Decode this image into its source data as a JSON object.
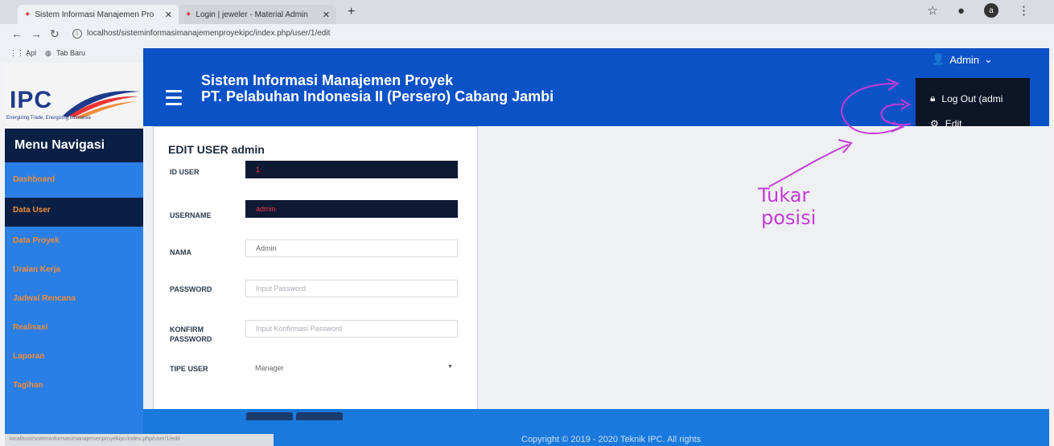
{
  "browser": {
    "tabs": [
      {
        "title": "Sistem Informasi Manajemen Pro",
        "close": "✕"
      },
      {
        "title": "Login | jeweler - Material Admin",
        "close": "✕"
      }
    ],
    "new_tab": "+",
    "url": "localhost/sisteminformasimanajemenproyekipc/index.php/user/1/edit",
    "bookmarks": [
      "Apl",
      "Tab Baru"
    ],
    "profile_initial": "a"
  },
  "app": {
    "logo": "IPC",
    "logo_tagline": "Energizing Trade, Energizing Indonesia",
    "header_title": "Sistem Informasi Manajemen Proyek",
    "header_subtitle": "PT. Pelabuhan Indonesia II (Persero) Cabang Jambi",
    "user_menu": "Admin",
    "dropdown": [
      {
        "label": "Log Out (admi",
        "icon": "lock-icon"
      },
      {
        "label": "Edit",
        "icon": "gear-icon"
      }
    ]
  },
  "sidebar": {
    "title": "Menu Navigasi",
    "items": [
      {
        "label": "Dashboard",
        "active": false
      },
      {
        "label": "Data User",
        "active": true
      },
      {
        "label": "Data Proyek",
        "active": false
      },
      {
        "label": "Uraian Kerja",
        "active": false
      },
      {
        "label": "Jadwal Rencana",
        "active": false
      },
      {
        "label": "Realisasi",
        "active": false
      },
      {
        "label": "Laporan",
        "active": false
      },
      {
        "label": "Tagihan",
        "active": false
      }
    ]
  },
  "form": {
    "title": "EDIT USER admin",
    "fields": [
      {
        "label": "ID USER",
        "value": "1"
      },
      {
        "label": "USERNAME",
        "value": "admin"
      },
      {
        "label": "NAMA",
        "value": "Admin"
      },
      {
        "label": "PASSWORD",
        "placeholder": "Input Password"
      },
      {
        "label": "KONFIRM PASSWORD",
        "placeholder": "Input Konfirmasi Password"
      },
      {
        "label": "TIPE USER",
        "value": "Manager"
      }
    ]
  },
  "footer": {
    "text": "Copyright © 2019 - 2020 Teknik IPC. All rights"
  },
  "annotation": {
    "line1": "Tukar",
    "line2": "posisi",
    "color": "#c43bd8"
  },
  "colors": {
    "header": "#0c52c7",
    "sidebar": "#2a7fe6",
    "sidebar_dark": "#0a1f44",
    "sidebar_text": "#f28c3a"
  }
}
